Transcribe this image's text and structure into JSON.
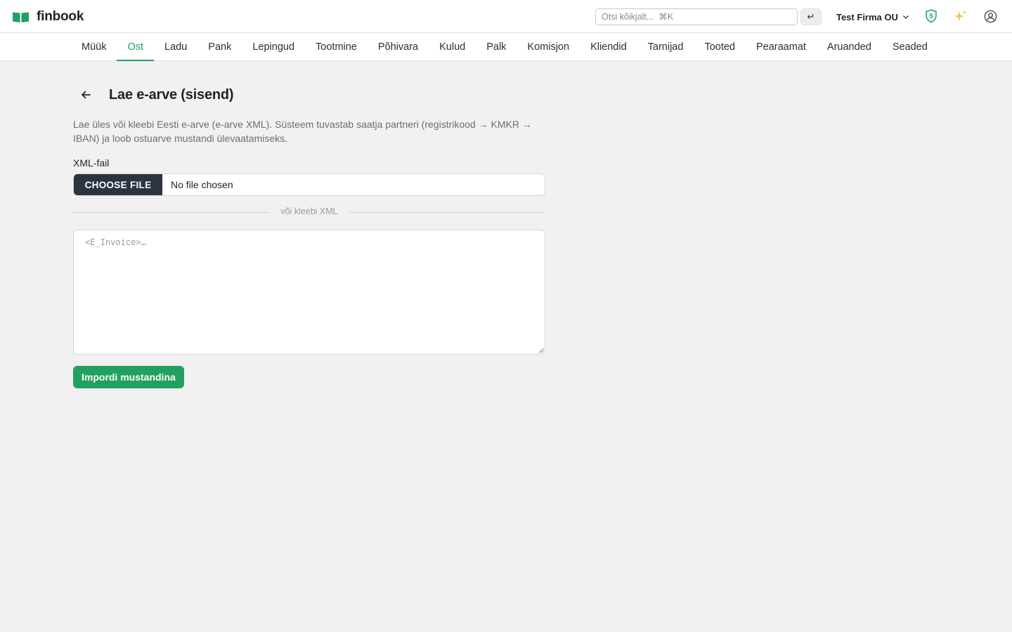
{
  "app": {
    "name": "finbook",
    "search_placeholder": "Otsi kõikjalt...  ⌘K",
    "enter_symbol": "↵",
    "company": "Test Firma OU",
    "brand_color": "#22a060"
  },
  "nav": {
    "items": [
      {
        "label": "Müük"
      },
      {
        "label": "Ost"
      },
      {
        "label": "Ladu"
      },
      {
        "label": "Pank"
      },
      {
        "label": "Lepingud"
      },
      {
        "label": "Tootmine"
      },
      {
        "label": "Põhivara"
      },
      {
        "label": "Kulud"
      },
      {
        "label": "Palk"
      },
      {
        "label": "Komisjon"
      },
      {
        "label": "Kliendid"
      },
      {
        "label": "Tarnijad"
      },
      {
        "label": "Tooted"
      },
      {
        "label": "Pearaamat"
      },
      {
        "label": "Aruanded"
      },
      {
        "label": "Seaded"
      }
    ],
    "active": "Ost"
  },
  "page": {
    "title": "Lae e-arve (sisend)",
    "description": "Lae üles või kleebi Eesti e-arve (e-arve XML). Süsteem tuvastab saatja partneri (registrikood → KMKR → IBAN) ja loob ostuarve mustandi ülevaatamiseks.",
    "xml_file_label": "XML-fail",
    "choose_file_label": "CHOOSE FILE",
    "file_status": "No file chosen",
    "divider_text": "või kleebi XML",
    "xml_placeholder": "<E_Invoice>…",
    "import_button": "Impordi mustandina"
  }
}
